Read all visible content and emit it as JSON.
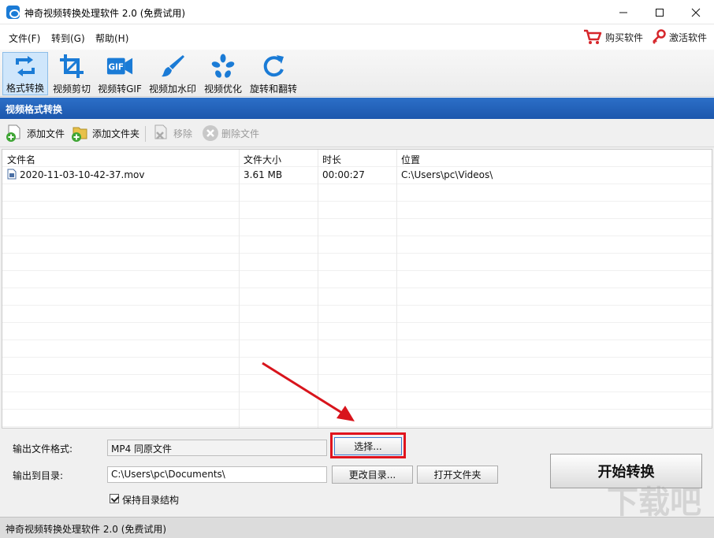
{
  "window": {
    "title": "神奇视频转换处理软件 2.0 (免费试用)"
  },
  "menu": {
    "file": "文件(F)",
    "goto": "转到(G)",
    "help": "帮助(H)",
    "buy": "购买软件",
    "activate": "激活软件"
  },
  "toolbar": {
    "items": [
      {
        "label": "格式转换",
        "icon": "convert-icon"
      },
      {
        "label": "视频剪切",
        "icon": "crop-icon"
      },
      {
        "label": "视频转GIF",
        "icon": "gif-icon"
      },
      {
        "label": "视频加水印",
        "icon": "brush-icon"
      },
      {
        "label": "视频优化",
        "icon": "optimize-icon"
      },
      {
        "label": "旋转和翻转",
        "icon": "rotate-icon"
      }
    ],
    "gif_text": "GIF"
  },
  "section": {
    "title": "视频格式转换"
  },
  "subtoolbar": {
    "add_file": "添加文件",
    "add_folder": "添加文件夹",
    "remove": "移除",
    "delete_file": "删除文件"
  },
  "table": {
    "headers": [
      "文件名",
      "文件大小",
      "时长",
      "位置"
    ],
    "rows": [
      {
        "name": "2020-11-03-10-42-37.mov",
        "size": "3.61 MB",
        "duration": "00:00:27",
        "location": "C:\\Users\\pc\\Videos\\"
      }
    ]
  },
  "output": {
    "format_label": "输出文件格式:",
    "format_value": "MP4 同原文件",
    "select_button": "选择...",
    "dir_label": "输出到目录:",
    "dir_value": "C:\\Users\\pc\\Documents\\",
    "change_dir_button": "更改目录...",
    "open_folder_button": "打开文件夹",
    "keep_structure_label": "保持目录结构",
    "start_button": "开始转换"
  },
  "status": {
    "text": "神奇视频转换处理软件 2.0 (免费试用)"
  },
  "watermark": {
    "text": "下载吧"
  },
  "colors": {
    "accent": "#1c5fb8",
    "highlight": "#e0141e",
    "icon_blue": "#1a7bd6"
  }
}
